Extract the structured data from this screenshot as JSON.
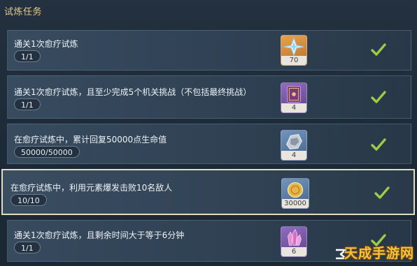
{
  "header": {
    "title": "试炼任务"
  },
  "tasks": [
    {
      "description": "通关1次愈疗试炼",
      "progress": "1/1",
      "reward": {
        "icon": "starglitter-icon",
        "count": "70",
        "color": "#d79a42"
      },
      "completed": true
    },
    {
      "description": "通关1次愈疗试炼，且至少完成5个机关挑战（不包括最终挑战）",
      "progress": "1/1",
      "reward": {
        "icon": "book-icon",
        "count": "4",
        "color": "#7a5aa8"
      },
      "completed": true
    },
    {
      "description": "在愈疗试炼中，累计回复50000点生命值",
      "progress": "50000/50000",
      "reward": {
        "icon": "ore-icon",
        "count": "4",
        "color": "#5b7fa6"
      },
      "completed": true
    },
    {
      "description": "在愈疗试炼中，利用元素爆发击败10名敌人",
      "progress": "10/10",
      "reward": {
        "icon": "mora-coin-icon",
        "count": "30000",
        "color": "#5b7fa6"
      },
      "completed": true
    },
    {
      "description": "通关1次愈疗试炼，且剩余时间大于等于6分钟",
      "progress": "1/1",
      "reward": {
        "icon": "crystal-icon",
        "count": "6",
        "color": "#7a5aa8"
      },
      "completed": true
    }
  ],
  "watermark": {
    "text": "天成手游网"
  },
  "colors": {
    "accent": "#e6c98f",
    "check": "#9ccc45"
  }
}
